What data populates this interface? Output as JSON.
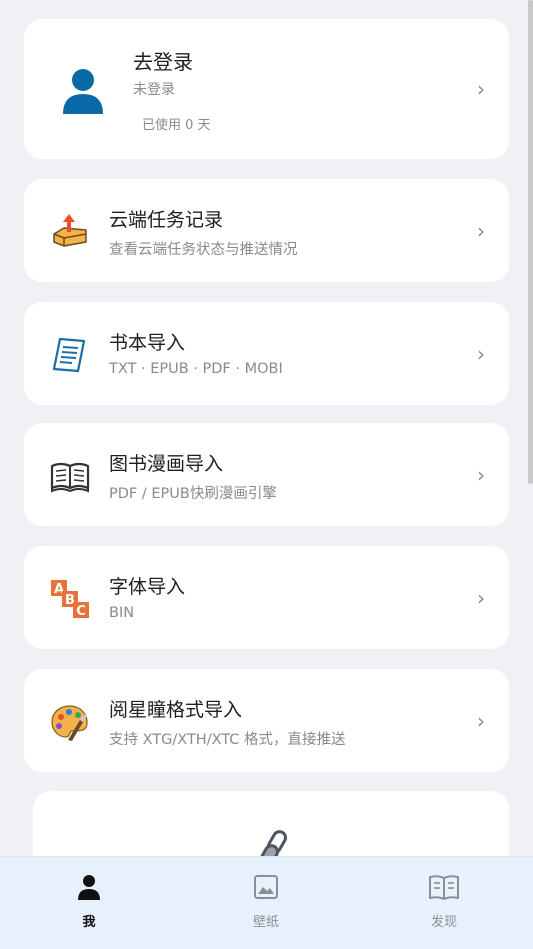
{
  "profile": {
    "title": "去登录",
    "status": "未登录",
    "usage": "已使用 0 天"
  },
  "menu": [
    {
      "title": "云端任务记录",
      "subtitle": "查看云端任务状态与推送情况",
      "icon": "cloud-task-tray-icon"
    },
    {
      "title": "书本导入",
      "subtitle": "TXT · EPUB · PDF · MOBI",
      "icon": "document-icon"
    },
    {
      "title": "图书漫画导入",
      "subtitle": "PDF / EPUB快刷漫画引擎",
      "icon": "open-book-icon"
    },
    {
      "title": "字体导入",
      "subtitle": "BIN",
      "icon": "abc-blocks-icon"
    },
    {
      "title": "阅星瞳格式导入",
      "subtitle": "支持 XTG/XTH/XTC 格式，直接推送",
      "icon": "palette-icon"
    }
  ],
  "chevron": "›",
  "bottom_nav": [
    {
      "label": "我",
      "icon": "person-icon",
      "active": true
    },
    {
      "label": "壁纸",
      "icon": "image-icon",
      "active": false
    },
    {
      "label": "发现",
      "icon": "book-icon",
      "active": false
    }
  ]
}
